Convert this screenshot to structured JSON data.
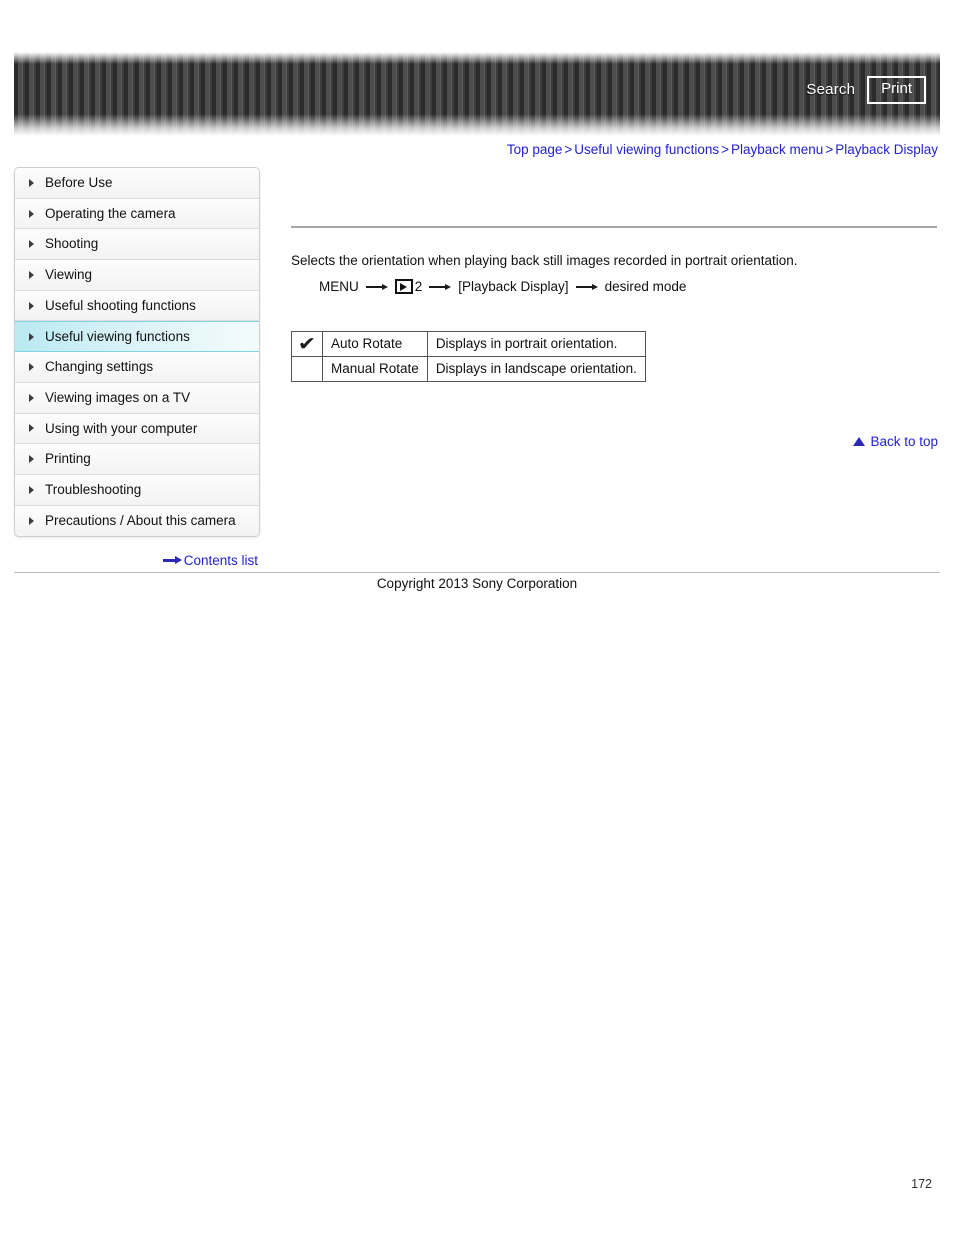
{
  "header": {
    "search_label": "Search",
    "print_label": "Print",
    "search_icon": "search-icon",
    "print_icon": "printer-icon"
  },
  "breadcrumb": {
    "separator": ">",
    "items": [
      {
        "label": "Top page"
      },
      {
        "label": "Useful viewing functions"
      },
      {
        "label": "Playback menu"
      },
      {
        "label": "Playback Display"
      }
    ]
  },
  "sidebar": {
    "items": [
      {
        "label": "Before Use",
        "active": false
      },
      {
        "label": "Operating the camera",
        "active": false
      },
      {
        "label": "Shooting",
        "active": false
      },
      {
        "label": "Viewing",
        "active": false
      },
      {
        "label": "Useful shooting functions",
        "active": false
      },
      {
        "label": "Useful viewing functions",
        "active": true
      },
      {
        "label": "Changing settings",
        "active": false
      },
      {
        "label": "Viewing images on a TV",
        "active": false
      },
      {
        "label": "Using with your computer",
        "active": false
      },
      {
        "label": "Printing",
        "active": false
      },
      {
        "label": "Troubleshooting",
        "active": false
      },
      {
        "label": "Precautions / About this camera",
        "active": false
      }
    ],
    "contents_list_label": "Contents list",
    "contents_list_icon": "arrow-right-icon"
  },
  "main": {
    "description": "Selects the orientation when playing back still images recorded in portrait orientation.",
    "menu_path": {
      "start": "MENU",
      "playback_icon": "playback-triangle-icon",
      "tab_number": "2",
      "setting": "[Playback Display]",
      "end": "desired mode"
    },
    "options_table": {
      "rows": [
        {
          "selected_mark": "✔",
          "is_selected": true,
          "name": "Auto Rotate",
          "description": "Displays in portrait orientation."
        },
        {
          "selected_mark": "",
          "is_selected": false,
          "name": "Manual Rotate",
          "description": "Displays in landscape orientation."
        }
      ]
    },
    "back_to_top_label": "Back to top",
    "back_to_top_icon": "triangle-up-icon"
  },
  "footer": {
    "copyright": "Copyright 2013 Sony Corporation",
    "page_number": "172"
  },
  "colors": {
    "link": "#2222cc",
    "active_nav": "#b9e9f2",
    "header_dark": "#2b2b2b"
  }
}
